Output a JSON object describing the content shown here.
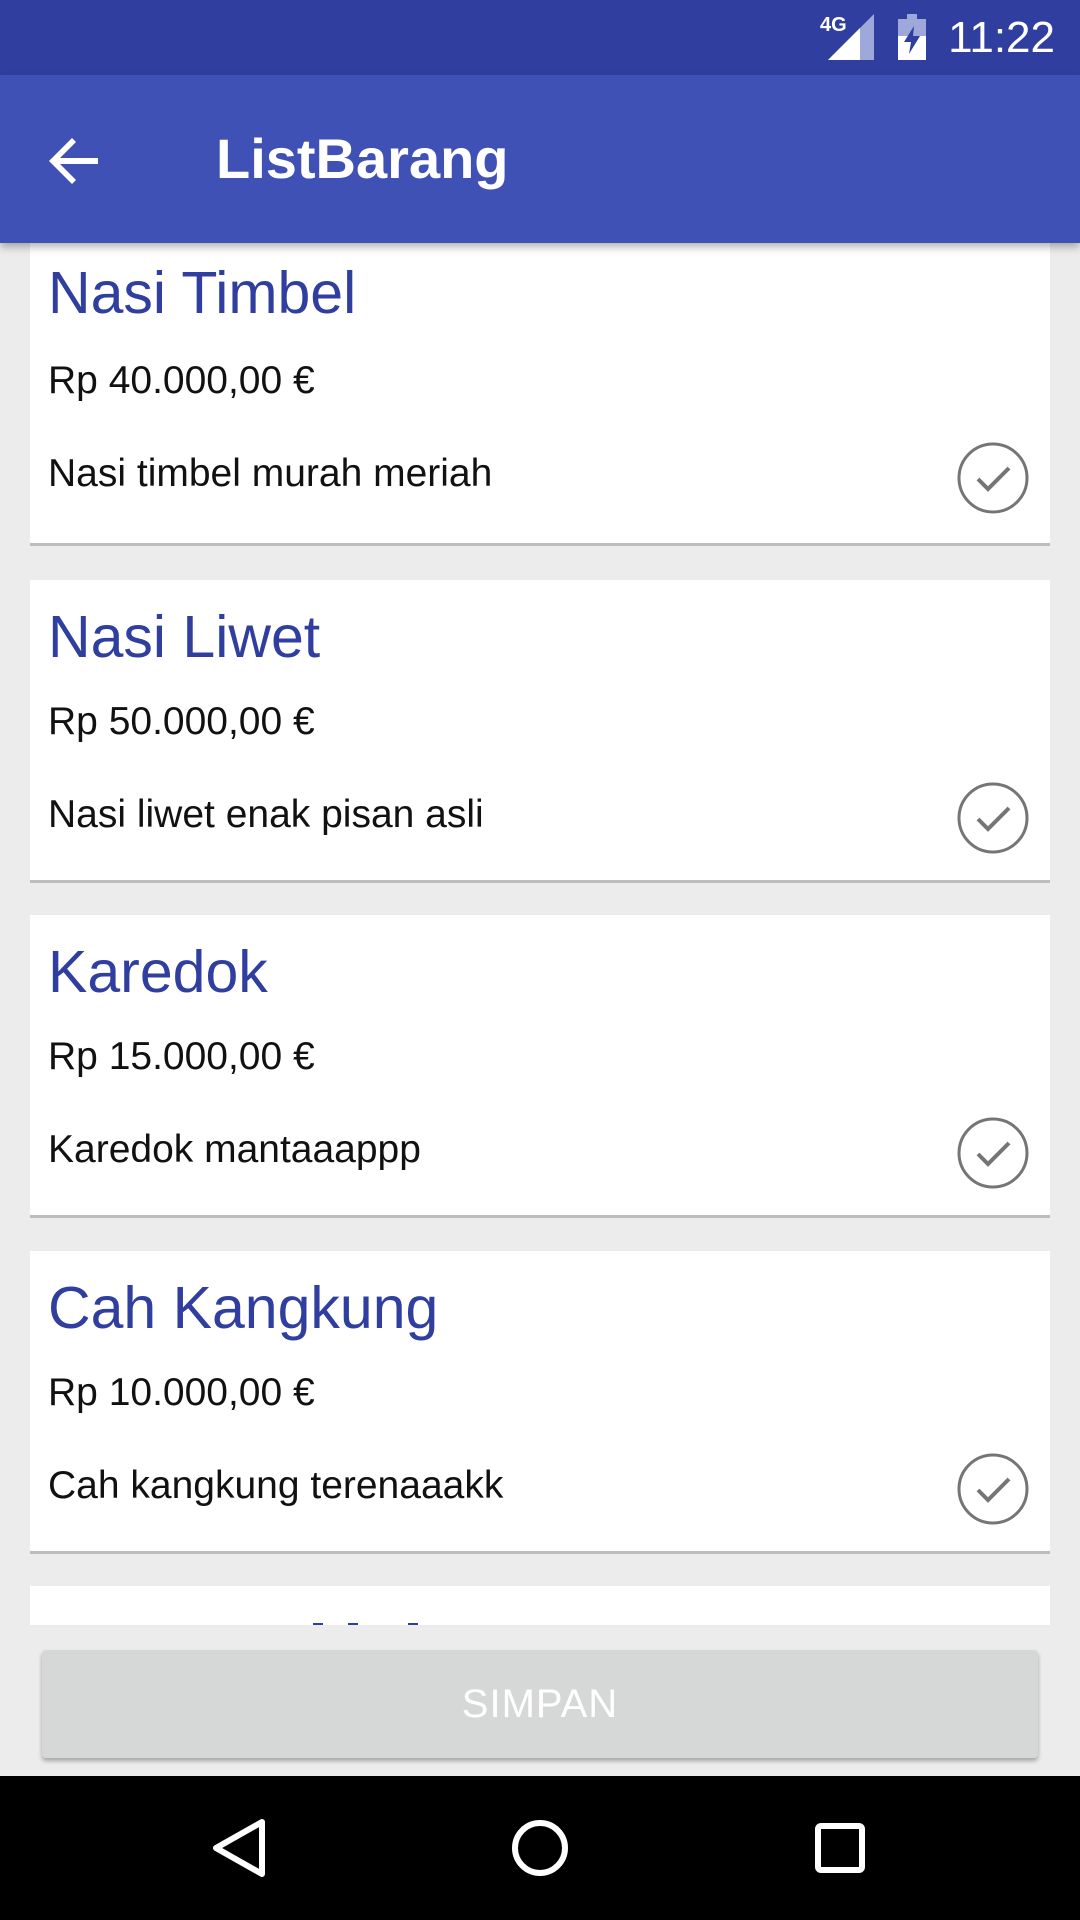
{
  "status_bar": {
    "network": "4G",
    "time": "11:22"
  },
  "app_bar": {
    "title": "ListBarang",
    "back_icon": "arrow-back-icon"
  },
  "items": [
    {
      "name": "Nasi Timbel",
      "price": "Rp 40.000,00 €",
      "description": "Nasi timbel murah meriah"
    },
    {
      "name": "Nasi Liwet",
      "price": "Rp 50.000,00 €",
      "description": "Nasi liwet enak pisan asli"
    },
    {
      "name": "Karedok",
      "price": "Rp 15.000,00 €",
      "description": "Karedok mantaaappp"
    },
    {
      "name": "Cah Kangkung",
      "price": "Rp 10.000,00 €",
      "description": "Cah kangkung terenaaakk"
    }
  ],
  "save_button": {
    "label": "SIMPAN"
  },
  "colors": {
    "status_bar": "#303f9f",
    "app_bar": "#3f51b5",
    "item_title": "#303f9f",
    "background": "#ececec",
    "button_disabled": "#d6d7d7"
  }
}
